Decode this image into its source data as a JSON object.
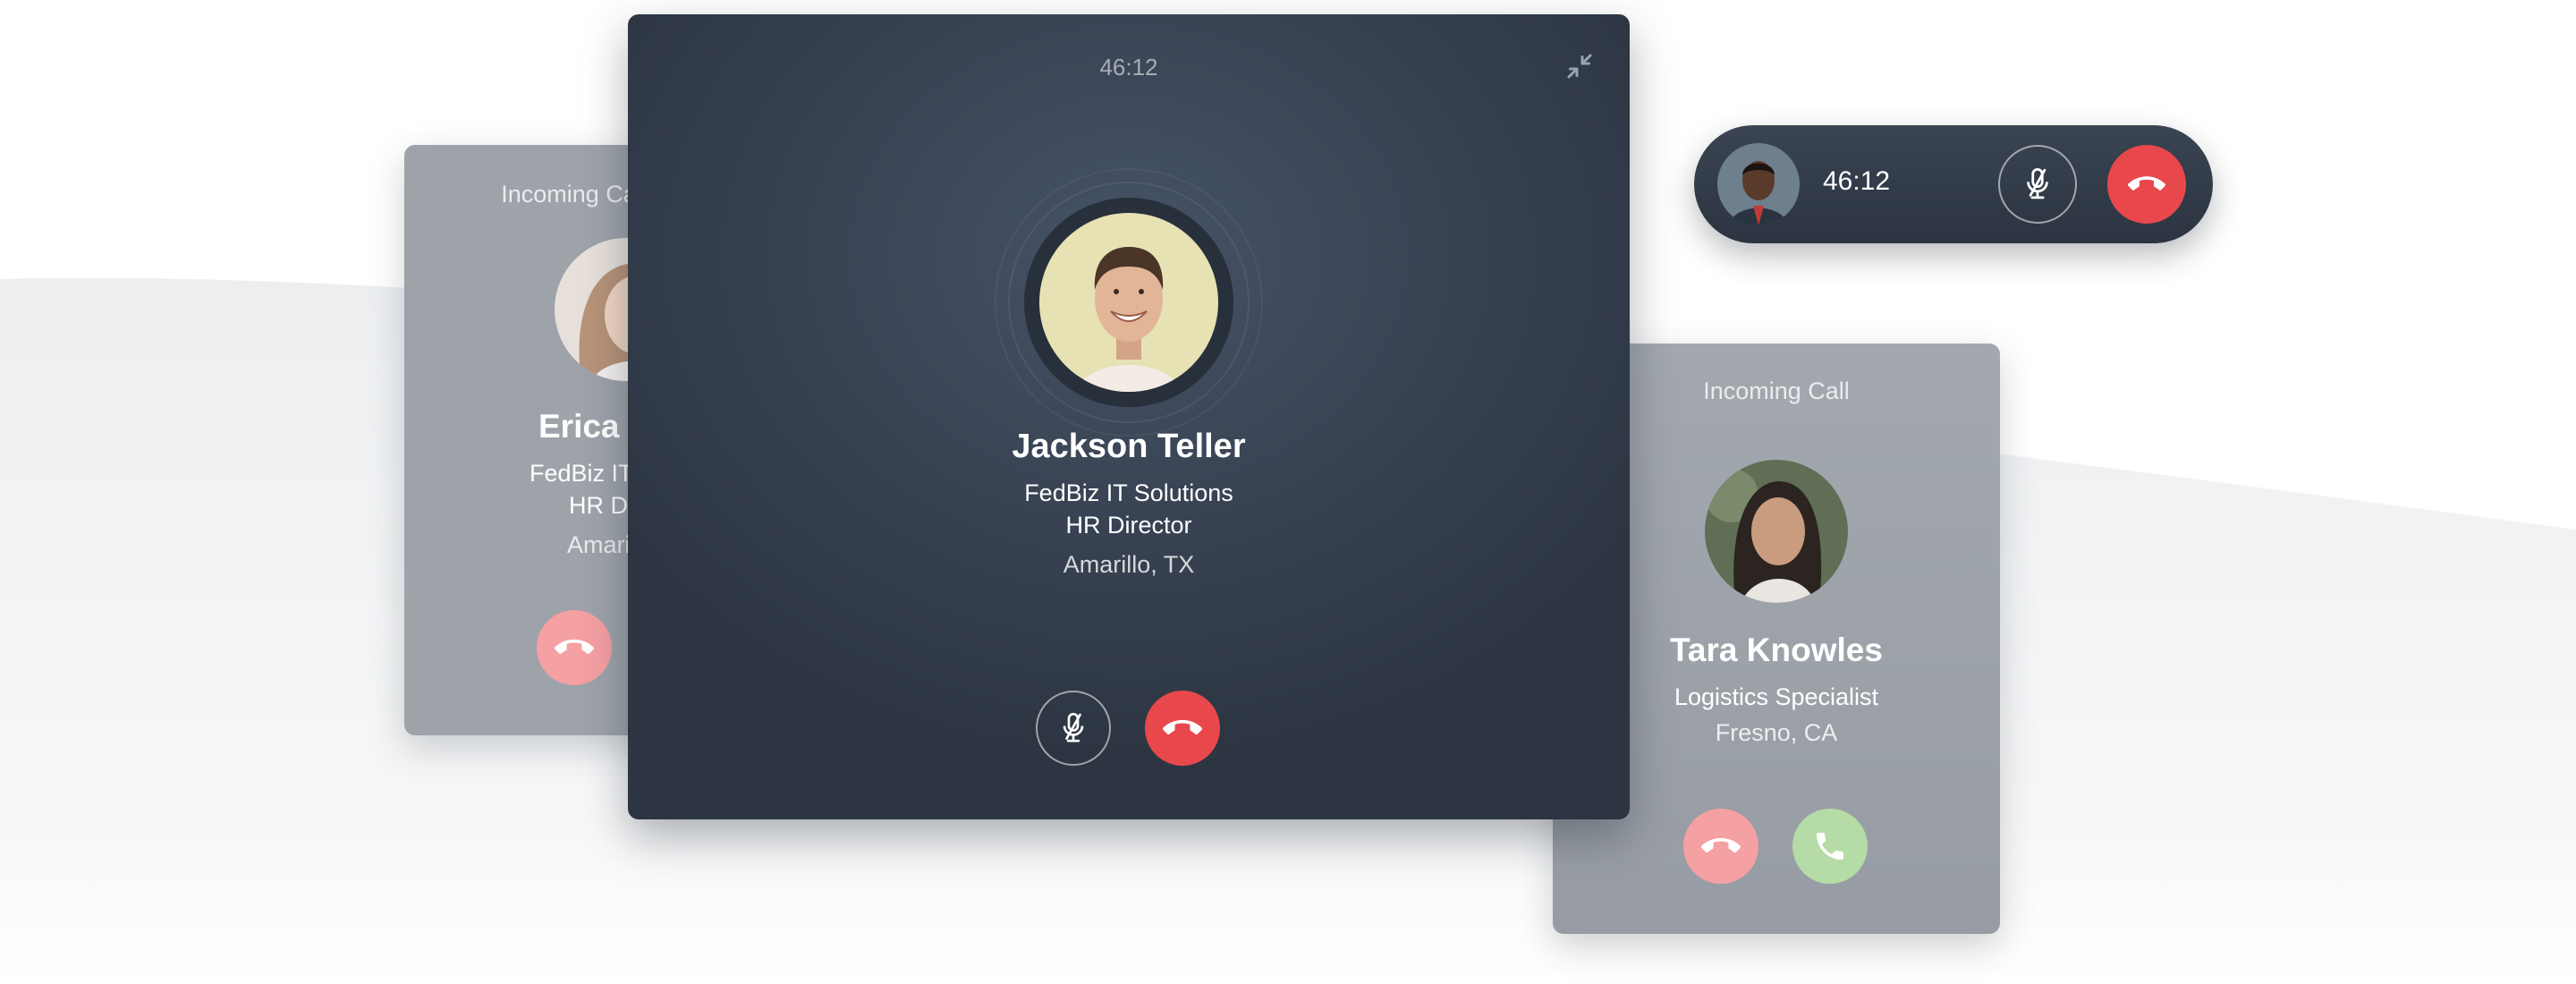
{
  "erica_card": {
    "incoming_label": "Incoming Call",
    "name": "Erica",
    "company": "FedBiz IT Solutions",
    "role": "HR Director",
    "location": "Amarillo, TX"
  },
  "main_call": {
    "timer": "46:12",
    "name": "Jackson Teller",
    "company": "FedBiz IT Solutions",
    "role": "HR Director",
    "location": "Amarillo, TX"
  },
  "mini_call": {
    "timer": "46:12"
  },
  "tara_card": {
    "incoming_label": "Incoming Call",
    "name": "Tara Knowles",
    "role": "Logistics Specialist",
    "location": "Fresno, CA"
  },
  "colors": {
    "hangup": "#e8484c",
    "decline_faded": "#f5a0a3",
    "accept_faded": "#b5dba6",
    "window_dark": "#2d3542"
  },
  "icons": [
    "minimize-icon",
    "microphone-off-icon",
    "phone-hangup-icon",
    "phone-icon"
  ]
}
